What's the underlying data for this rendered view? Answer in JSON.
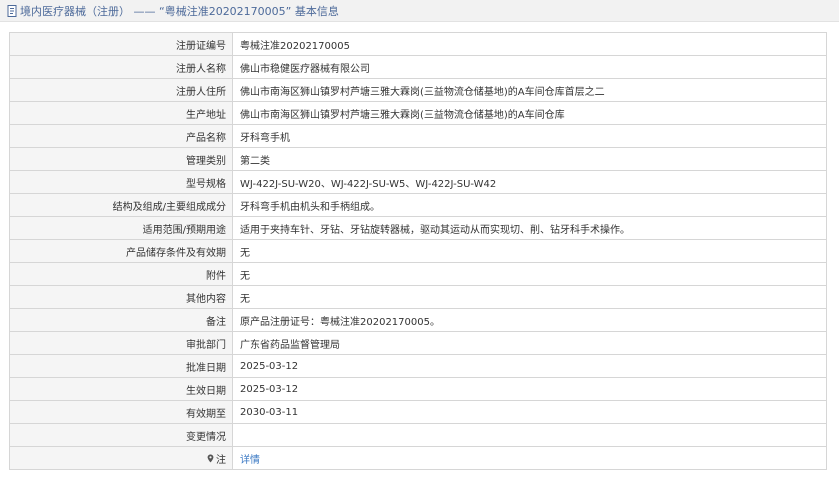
{
  "header": {
    "title": "境内医疗器械（注册） —— “粤械注准20202170005” 基本信息"
  },
  "rows": [
    {
      "label": "注册证编号",
      "value": "粤械注准20202170005"
    },
    {
      "label": "注册人名称",
      "value": "佛山市稳健医疗器械有限公司"
    },
    {
      "label": "注册人住所",
      "value": "佛山市南海区狮山镇罗村芦塘三雅大霖岗(三益物流仓储基地)的A车间仓库首层之二"
    },
    {
      "label": "生产地址",
      "value": "佛山市南海区狮山镇罗村芦塘三雅大霖岗(三益物流仓储基地)的A车间仓库"
    },
    {
      "label": "产品名称",
      "value": "牙科弯手机"
    },
    {
      "label": "管理类别",
      "value": "第二类"
    },
    {
      "label": "型号规格",
      "value": "WJ-422J-SU-W20、WJ-422J-SU-W5、WJ-422J-SU-W42"
    },
    {
      "label": "结构及组成/主要组成成分",
      "value": "牙科弯手机由机头和手柄组成。"
    },
    {
      "label": "适用范围/预期用途",
      "value": "适用于夹持车针、牙钻、牙钻旋转器械，驱动其运动从而实现切、削、钻牙科手术操作。"
    },
    {
      "label": "产品储存条件及有效期",
      "value": "无"
    },
    {
      "label": "附件",
      "value": "无"
    },
    {
      "label": "其他内容",
      "value": "无"
    },
    {
      "label": "备注",
      "value": "原产品注册证号：粤械注准20202170005。"
    },
    {
      "label": "审批部门",
      "value": "广东省药品监督管理局"
    },
    {
      "label": "批准日期",
      "value": "2025-03-12"
    },
    {
      "label": "生效日期",
      "value": "2025-03-12"
    },
    {
      "label": "有效期至",
      "value": "2030-03-11"
    },
    {
      "label": "变更情况",
      "value": ""
    }
  ],
  "note_row": {
    "label": "注",
    "link_text": "详情"
  },
  "colors": {
    "title_text": "#4d6a9a",
    "link": "#3a78c3",
    "label_bg": "#f5f5f5",
    "border": "#d6d6d6"
  }
}
